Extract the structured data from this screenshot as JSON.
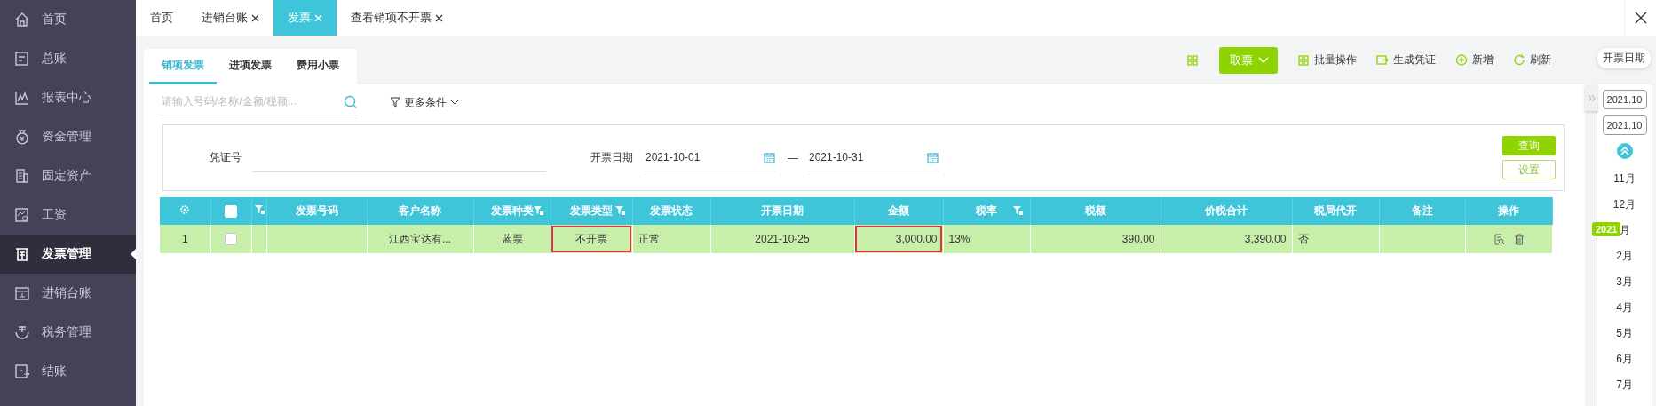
{
  "sidebar": {
    "items": [
      {
        "label": "首页",
        "selected": false
      },
      {
        "label": "总账",
        "selected": false
      },
      {
        "label": "报表中心",
        "selected": false
      },
      {
        "label": "资金管理",
        "selected": false
      },
      {
        "label": "固定资产",
        "selected": false
      },
      {
        "label": "工资",
        "selected": false
      },
      {
        "label": "发票管理",
        "selected": true
      },
      {
        "label": "进销台账",
        "selected": false
      },
      {
        "label": "税务管理",
        "selected": false
      },
      {
        "label": "结账",
        "selected": false
      }
    ]
  },
  "tabs": [
    {
      "label": "首页",
      "closable": false,
      "selected": false
    },
    {
      "label": "进销台账",
      "closable": true,
      "selected": false
    },
    {
      "label": "发票",
      "closable": true,
      "selected": true
    },
    {
      "label": "查看销项不开票",
      "closable": true,
      "selected": false
    }
  ],
  "sub_tabs": [
    {
      "label": "销项发票",
      "selected": true
    },
    {
      "label": "进项发票",
      "selected": false
    },
    {
      "label": "费用小票",
      "selected": false
    }
  ],
  "toolbar": {
    "primary": "取票",
    "actions": [
      "批量操作",
      "生成凭证",
      "新增",
      "刷新"
    ]
  },
  "search": {
    "placeholder": "请输入号码/名称/金额/税额...",
    "more": "更多条件"
  },
  "filters": {
    "voucher_label": "凭证号",
    "date_label": "开票日期",
    "date_from": "2021-10-01",
    "separator": "—",
    "date_to": "2021-10-31",
    "query": "查询",
    "settings": "设置"
  },
  "table": {
    "columns": [
      {
        "kind": "settings"
      },
      {
        "kind": "checkbox",
        "checked": false
      },
      {
        "kind": "filter"
      },
      {
        "kind": "text",
        "label": "发票号码",
        "filter": false
      },
      {
        "kind": "text",
        "label": "客户名称",
        "filter": false
      },
      {
        "kind": "text",
        "label": "发票种类",
        "filter": true
      },
      {
        "kind": "text",
        "label": "发票类型",
        "filter": true
      },
      {
        "kind": "text",
        "label": "发票状态",
        "filter": false
      },
      {
        "kind": "text",
        "label": "开票日期",
        "filter": false
      },
      {
        "kind": "text",
        "label": "金额",
        "filter": false
      },
      {
        "kind": "text",
        "label": "税率",
        "filter": true
      },
      {
        "kind": "text",
        "label": "税额",
        "filter": false
      },
      {
        "kind": "text",
        "label": "价税合计",
        "filter": false
      },
      {
        "kind": "text",
        "label": "税局代开",
        "filter": false
      },
      {
        "kind": "text",
        "label": "备注",
        "filter": false
      },
      {
        "kind": "text",
        "label": "操作",
        "filter": false
      }
    ],
    "rows": [
      {
        "selected": true,
        "cells": [
          {
            "kind": "text",
            "text": "1",
            "highlighted": false
          },
          {
            "kind": "checkbox",
            "checked": false,
            "highlighted": false
          },
          {
            "kind": "text",
            "text": "",
            "highlighted": false
          },
          {
            "kind": "text",
            "text": "",
            "highlighted": false
          },
          {
            "kind": "text",
            "text": "江西宝达有...",
            "highlighted": false
          },
          {
            "kind": "text",
            "text": "蓝票",
            "highlighted": false
          },
          {
            "kind": "text",
            "text": "不开票",
            "highlighted": true
          },
          {
            "kind": "text",
            "text": "正常",
            "highlighted": false
          },
          {
            "kind": "text",
            "text": "2021-10-25",
            "highlighted": false
          },
          {
            "kind": "text",
            "text": "3,000.00",
            "highlighted": true
          },
          {
            "kind": "text",
            "text": "13%",
            "highlighted": false
          },
          {
            "kind": "text",
            "text": "390.00",
            "highlighted": false
          },
          {
            "kind": "text",
            "text": "3,390.00",
            "highlighted": false
          },
          {
            "kind": "text",
            "text": "否",
            "highlighted": false
          },
          {
            "kind": "text",
            "text": "",
            "highlighted": false
          },
          {
            "kind": "actions",
            "highlighted": false
          }
        ]
      }
    ]
  },
  "timeline": {
    "tooltip": "开票日期",
    "range": [
      "2021.10",
      "2021.10"
    ],
    "months": [
      {
        "label": "11月"
      },
      {
        "label": "12月"
      },
      {
        "label": "月",
        "year": "2021"
      },
      {
        "label": "2月"
      },
      {
        "label": "3月"
      },
      {
        "label": "4月"
      },
      {
        "label": "5月"
      },
      {
        "label": "6月"
      },
      {
        "label": "7月"
      }
    ]
  }
}
